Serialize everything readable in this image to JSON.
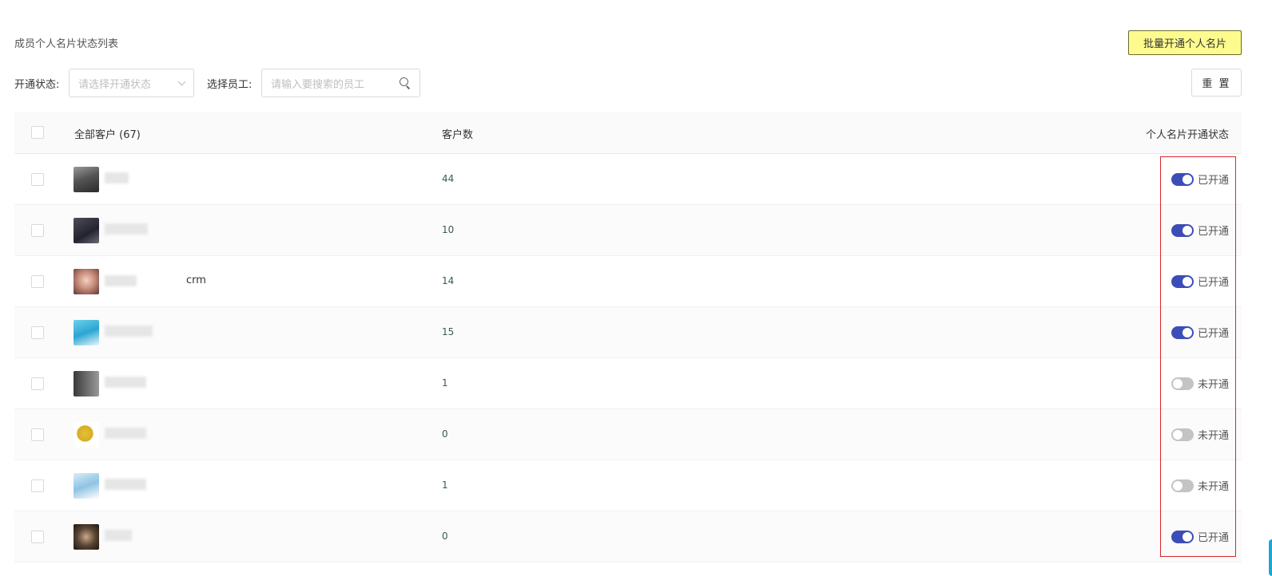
{
  "header": {
    "title": "成员个人名片状态列表",
    "batch_button": "批量开通个人名片"
  },
  "filters": {
    "status_label": "开通状态:",
    "status_placeholder": "请选择开通状态",
    "employee_label": "选择员工:",
    "employee_placeholder": "请输入要搜索的员工",
    "reset_button": "重 置"
  },
  "table": {
    "columns": {
      "name": "全部客户 (67)",
      "count": "客户数",
      "status": "个人名片开通状态"
    },
    "rows": [
      {
        "name_visible": "",
        "count": "44",
        "enabled": true,
        "status_text": "已开通",
        "avatar": "avatar-dark-figure"
      },
      {
        "name_visible": "",
        "count": "10",
        "enabled": true,
        "status_text": "已开通",
        "avatar": "avatar-dark-scene"
      },
      {
        "name_visible": "crm",
        "count": "14",
        "enabled": true,
        "status_text": "已开通",
        "avatar": "avatar-portrait"
      },
      {
        "name_visible": "",
        "count": "15",
        "enabled": true,
        "status_text": "已开通",
        "avatar": "avatar-sky-blue"
      },
      {
        "name_visible": "",
        "count": "1",
        "enabled": false,
        "status_text": "未开通",
        "avatar": "avatar-gray-gradient"
      },
      {
        "name_visible": "",
        "count": "0",
        "enabled": false,
        "status_text": "未开通",
        "avatar": "avatar-yellow-bear"
      },
      {
        "name_visible": "",
        "count": "1",
        "enabled": false,
        "status_text": "未开通",
        "avatar": "avatar-light-sky"
      },
      {
        "name_visible": "",
        "count": "0",
        "enabled": true,
        "status_text": "已开通",
        "avatar": "avatar-dark-portrait"
      }
    ]
  },
  "colors": {
    "toggle_on": "#3d4db7",
    "toggle_off": "#c4c4c4",
    "batch_button_bg": "#fdfb8e",
    "highlight_border": "#d9272e"
  }
}
